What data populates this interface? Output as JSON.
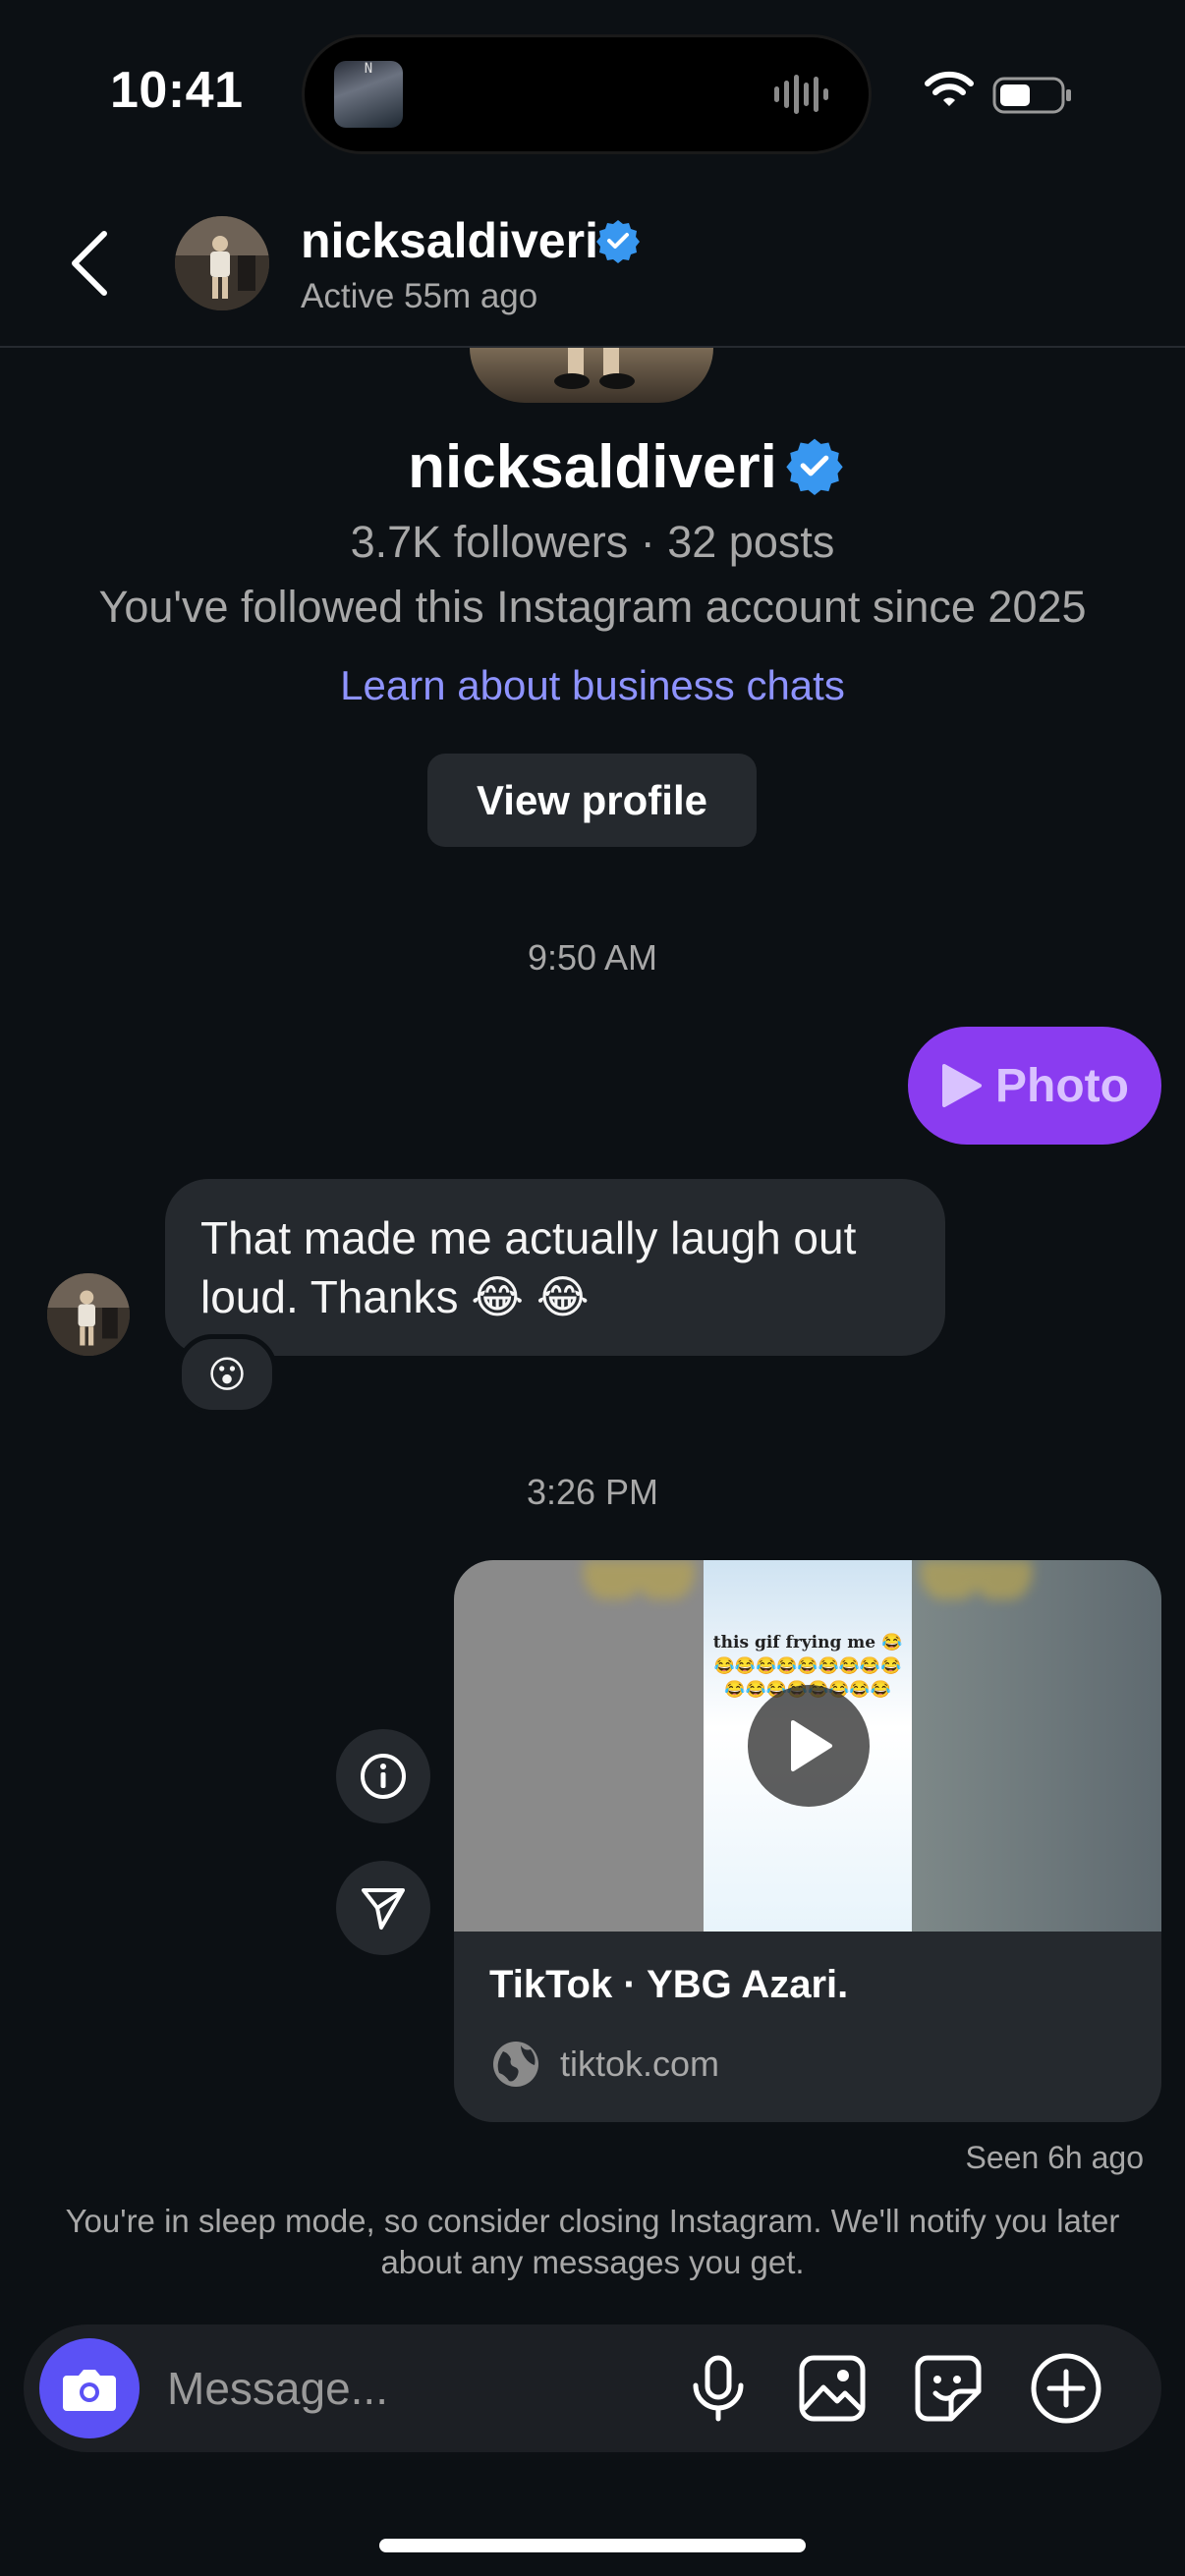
{
  "status_bar": {
    "time": "10:41",
    "island_thumb_label": "N"
  },
  "header": {
    "name": "nicksaldiveri",
    "status": "Active 55m ago"
  },
  "profile": {
    "name": "nicksaldiveri",
    "stats": "3.7K followers · 32 posts",
    "since": "You've followed this Instagram account since 2025",
    "business_link": "Learn about business chats",
    "view_profile": "View profile"
  },
  "messages": {
    "timestamp_1": "9:50 AM",
    "photo_label": "Photo",
    "incoming_text": "That made me actually laugh out loud. Thanks 😂 😂",
    "reaction": "😮",
    "timestamp_2": "3:26 PM",
    "link_card": {
      "caption": "this gif frying me 😂😂😂😂😂😂😂😂😂😂😂😂😂😂😂😂😂😂",
      "title": "TikTok · YBG Azari.",
      "domain": "tiktok.com"
    },
    "seen": "Seen 6h ago",
    "sleep_notice": "You're in sleep mode, so consider closing Instagram. We'll notify you later about any messages you get."
  },
  "composer": {
    "placeholder": "Message..."
  },
  "colors": {
    "background": "#0c1014",
    "bubble": "#25292e",
    "accent_purple": "#8a3cf0",
    "link_blue": "#8e93ff",
    "camera_blue": "#5b51f5",
    "verified_blue": "#3897f0"
  }
}
